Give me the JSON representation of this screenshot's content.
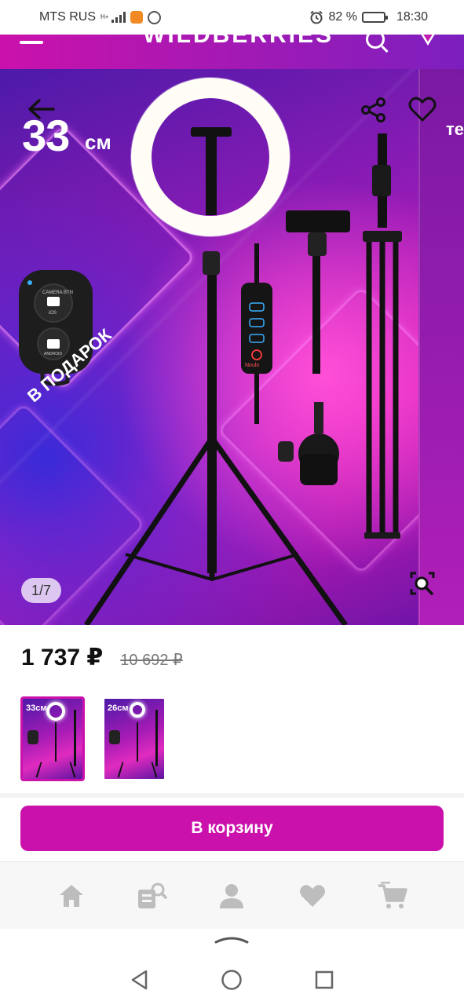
{
  "status_bar": {
    "carrier": "MTS RUS",
    "network": "H+",
    "battery_percent": "82 %",
    "battery_level": 0.82,
    "time": "18:30"
  },
  "header": {
    "brand": "WILDBERRIES"
  },
  "gallery": {
    "counter": "1/7",
    "size_number": "33",
    "size_unit": "см",
    "gift_label": "В ПОДАРОК",
    "next_slide_peek": "те",
    "remote_text_top": "CAMERA BTN",
    "remote_text_os": "iOS",
    "remote_text_bottom": "ANDROID",
    "controller_brand": "Noulo"
  },
  "price": {
    "current": "1 737 ₽",
    "old": "10 692 ₽"
  },
  "thumbnails": [
    {
      "label": "33см",
      "selected": true
    },
    {
      "label": "26см",
      "selected": false
    }
  ],
  "actions": {
    "add_to_cart": "В корзину"
  },
  "bottom_nav": [
    {
      "icon": "home-icon"
    },
    {
      "icon": "catalog-search-icon"
    },
    {
      "icon": "profile-icon"
    },
    {
      "icon": "heart-icon"
    },
    {
      "icon": "cart-icon"
    }
  ],
  "colors": {
    "brand": "#cb11ab",
    "brand_dark": "#7c1fbf"
  }
}
